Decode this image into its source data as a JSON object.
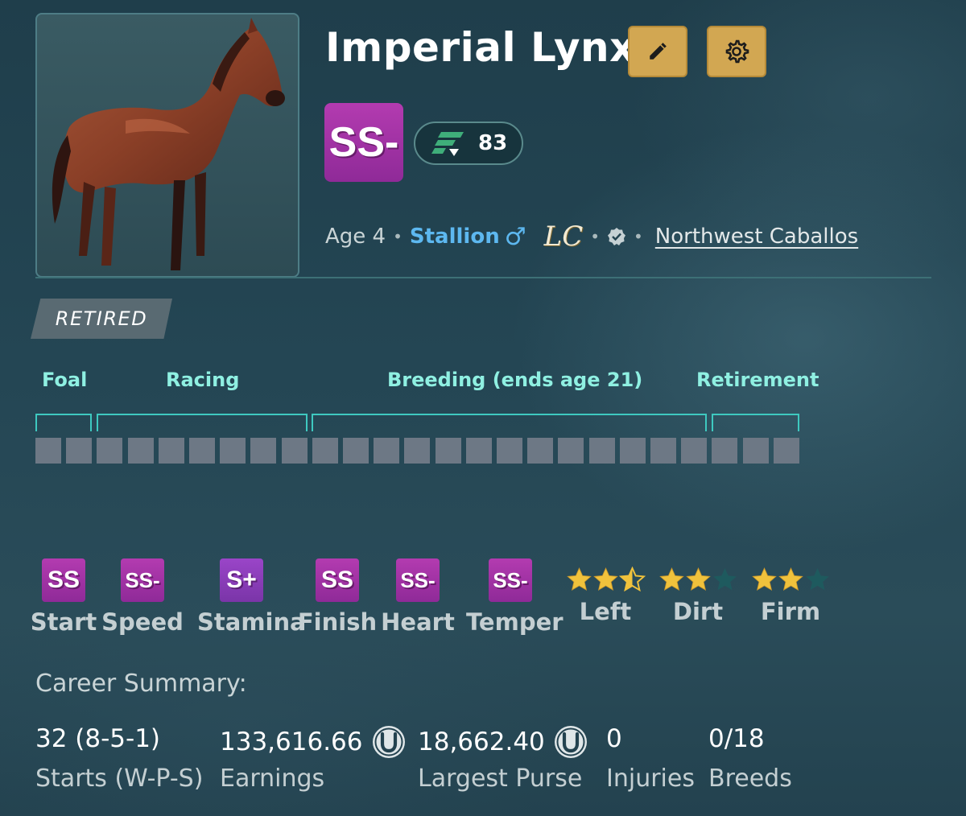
{
  "horse": {
    "name": "Imperial Lynx",
    "overall_grade": "SS-",
    "rating": "83",
    "age": "Age 4",
    "sex": "Stallion",
    "sex_symbol": "♂",
    "breeder_monogram": "LC",
    "owner": "Northwest Caballos",
    "status": "RETIRED"
  },
  "icons": {
    "edit": "pencil-icon",
    "settings": "gear-icon",
    "rating": "speed-rating-icon",
    "verified": "verified-badge-icon",
    "currency": "horseshoe-coin-icon"
  },
  "colors": {
    "gold_button": "#d2a752",
    "grade_purple": "#a534a6",
    "teal_accent": "#3ec9c0",
    "phase_text": "#8ff0e2",
    "sex_blue": "#5db8f0",
    "star_gold": "#f0c23c",
    "star_empty": "#1e5a5e"
  },
  "lifecycle": {
    "phases": [
      {
        "label": "Foal",
        "years": 2
      },
      {
        "label": "Racing",
        "years": 7
      },
      {
        "label": "Breeding (ends age 21)",
        "years": 13
      },
      {
        "label": "Retirement",
        "years": 3
      }
    ],
    "total_years": 25
  },
  "stats": [
    {
      "label": "Start",
      "grade": "SS"
    },
    {
      "label": "Speed",
      "grade": "SS-"
    },
    {
      "label": "Stamina",
      "grade": "S+"
    },
    {
      "label": "Finish",
      "grade": "SS"
    },
    {
      "label": "Heart",
      "grade": "SS-"
    },
    {
      "label": "Temper",
      "grade": "SS-"
    }
  ],
  "preferences": [
    {
      "label": "Left",
      "stars": 2.5
    },
    {
      "label": "Dirt",
      "stars": 2
    },
    {
      "label": "Firm",
      "stars": 2
    }
  ],
  "career": {
    "title": "Career Summary:",
    "starts": {
      "value": "32 (8-5-1)",
      "label": "Starts (W-P-S)"
    },
    "earnings": {
      "value": "133,616.66",
      "label": "Earnings"
    },
    "largest_purse": {
      "value": "18,662.40",
      "label": "Largest Purse"
    },
    "injuries": {
      "value": "0",
      "label": "Injuries"
    },
    "breeds": {
      "value": "0/18",
      "label": "Breeds"
    }
  }
}
